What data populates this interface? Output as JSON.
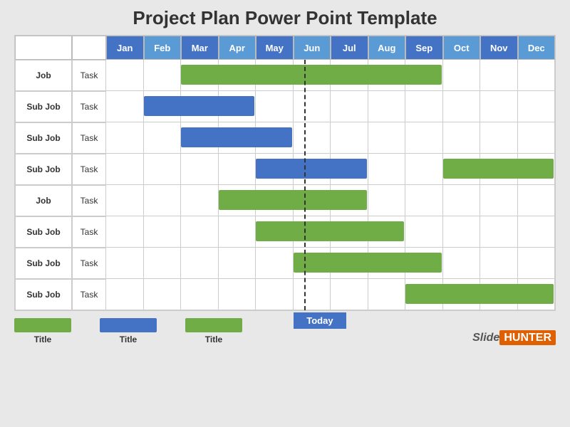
{
  "title": "Project Plan Power Point Template",
  "months": [
    "Jan",
    "Feb",
    "Mar",
    "Apr",
    "May",
    "Jun",
    "Jul",
    "Aug",
    "Sep",
    "Oct",
    "Nov",
    "Dec"
  ],
  "rows": [
    {
      "job": "Job",
      "task": "Task",
      "bars": [
        {
          "color": "green",
          "start": 2,
          "end": 9
        }
      ]
    },
    {
      "job": "Sub Job",
      "task": "Task",
      "bars": [
        {
          "color": "blue",
          "start": 1,
          "end": 4
        }
      ]
    },
    {
      "job": "Sub Job",
      "task": "Task",
      "bars": [
        {
          "color": "blue",
          "start": 2,
          "end": 5
        }
      ]
    },
    {
      "job": "Sub Job",
      "task": "Task",
      "bars": [
        {
          "color": "blue",
          "start": 4,
          "end": 7
        },
        {
          "color": "green",
          "start": 9,
          "end": 12
        }
      ]
    },
    {
      "job": "Job",
      "task": "Task",
      "bars": [
        {
          "color": "green",
          "start": 3,
          "end": 7
        }
      ]
    },
    {
      "job": "Sub Job",
      "task": "Task",
      "bars": [
        {
          "color": "green",
          "start": 4,
          "end": 8
        }
      ]
    },
    {
      "job": "Sub Job",
      "task": "Task",
      "bars": [
        {
          "color": "green",
          "start": 5,
          "end": 9
        }
      ]
    },
    {
      "job": "Sub Job",
      "task": "Task",
      "bars": [
        {
          "color": "green",
          "start": 8,
          "end": 12
        }
      ]
    }
  ],
  "today_label": "Today",
  "today_col": 5.3,
  "legend": [
    {
      "color": "#70AD47",
      "label": "Title"
    },
    {
      "color": "#4472C4",
      "label": "Title"
    },
    {
      "color": "#70AD47",
      "label": "Title"
    }
  ],
  "brand": {
    "slide": "Slide",
    "hunter": "HUNTER"
  }
}
